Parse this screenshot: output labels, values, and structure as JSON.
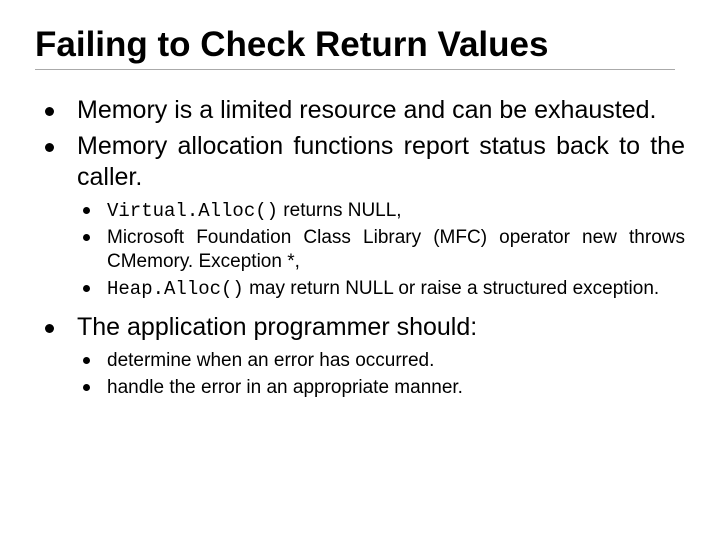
{
  "title": "Failing to Check Return Values",
  "bullets": {
    "b0": "Memory is a limited resource and can be exhausted.",
    "b1": "Memory allocation functions report status back to the caller.",
    "b1_sub": {
      "s0_code": "Virtual.Alloc()",
      "s0_rest": " returns NULL,",
      "s1": "Microsoft Foundation Class Library (MFC) operator new throws CMemory. Exception *,",
      "s2_code": "Heap.Alloc()",
      "s2_rest": " may return NULL or raise a structured exception."
    },
    "b2": "The application programmer should:",
    "b2_sub": {
      "s0": "determine when an error has occurred.",
      "s1": "handle the error in an appropriate manner."
    }
  }
}
